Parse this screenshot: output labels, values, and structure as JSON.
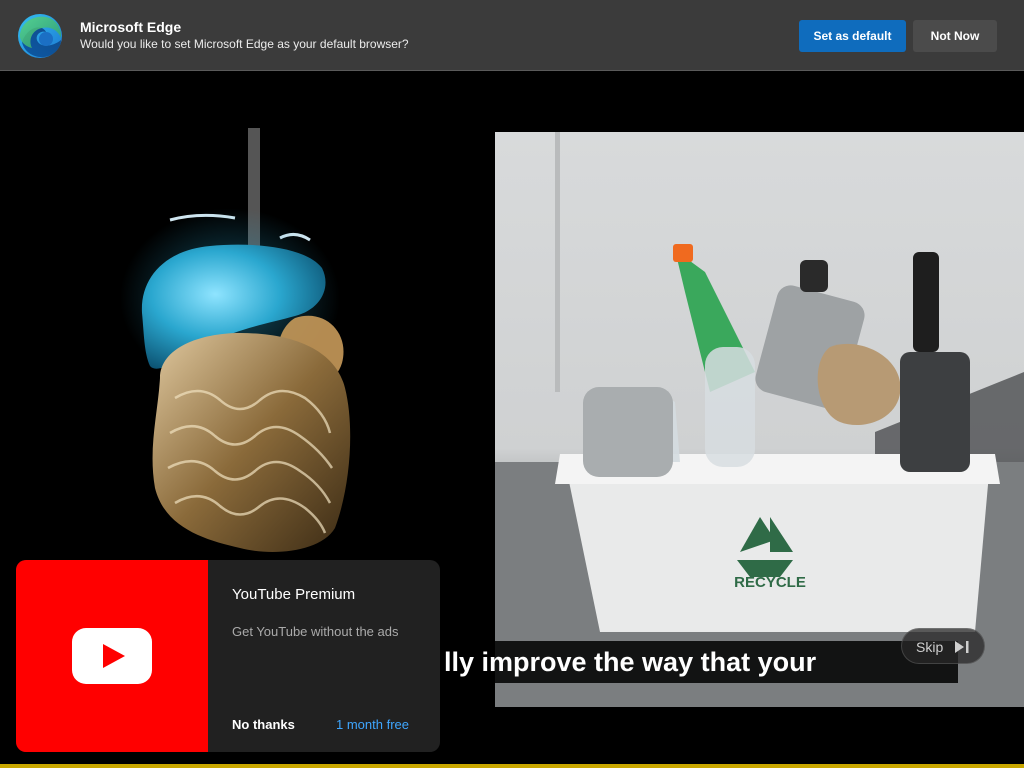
{
  "edge_prompt": {
    "title": "Microsoft Edge",
    "message": "Would you like to set Microsoft Edge as your default browser?",
    "set_default_label": "Set as default",
    "not_now_label": "Not Now",
    "accent_color": "#0f6cbd"
  },
  "video": {
    "caption": "lly improve the way that your",
    "skip_label": "Skip",
    "skip_icon": "skip-next-icon",
    "bin_label": "RECYCLE"
  },
  "promo": {
    "title": "YouTube Premium",
    "description": "Get YouTube without the ads",
    "no_thanks_label": "No thanks",
    "cta_label": "1 month free",
    "brand_color": "#ff0000",
    "icon": "youtube-play-icon"
  }
}
